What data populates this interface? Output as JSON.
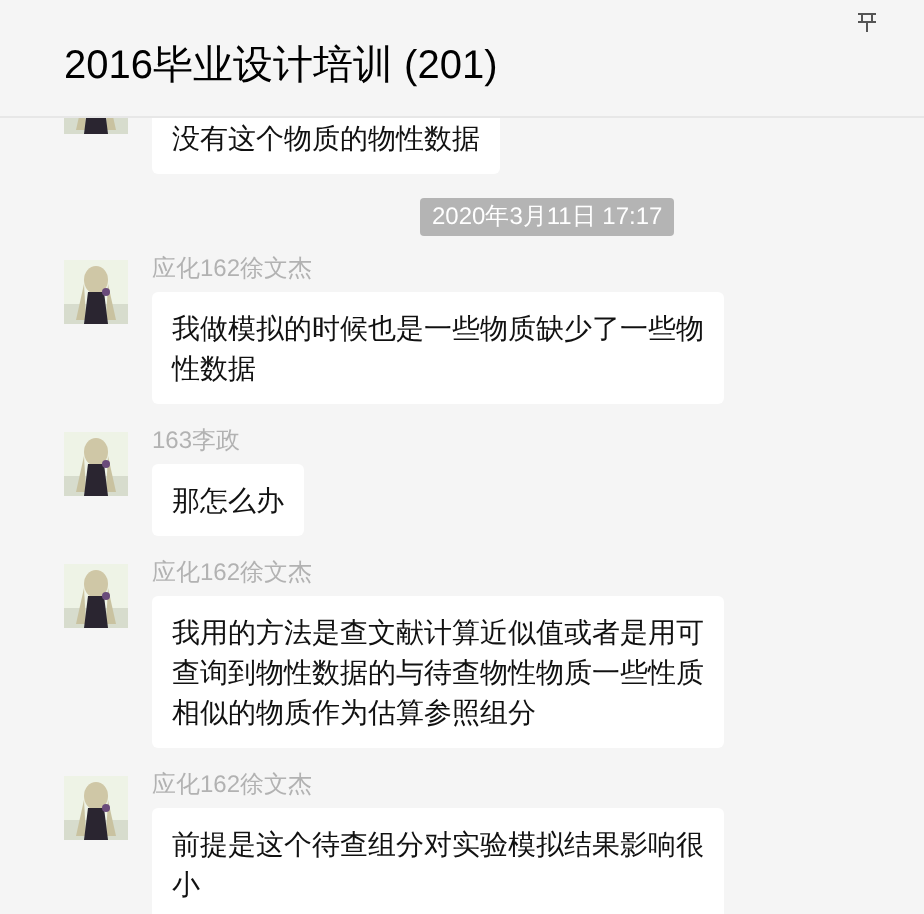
{
  "header": {
    "title": "2016毕业设计培训 (201)"
  },
  "messages": [
    {
      "kind": "message",
      "text": "没有这个物质的物性数据"
    },
    {
      "kind": "time",
      "text": "2020年3月11日 17:17"
    },
    {
      "kind": "message",
      "sender": "应化162徐文杰",
      "text": "我做模拟的时候也是一些物质缺少了一些物性数据"
    },
    {
      "kind": "message",
      "sender": "163李政",
      "text": "那怎么办"
    },
    {
      "kind": "message",
      "sender": "应化162徐文杰",
      "text": "我用的方法是查文献计算近似值或者是用可查询到物性数据的与待查物性物质一些性质相似的物质作为估算参照组分"
    },
    {
      "kind": "message",
      "sender": "应化162徐文杰",
      "text": "前提是这个待查组分对实验模拟结果影响很小"
    }
  ]
}
